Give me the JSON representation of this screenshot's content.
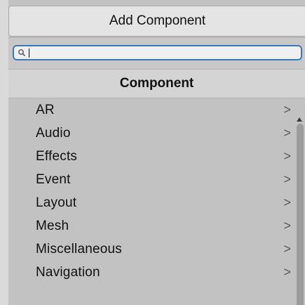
{
  "button": {
    "label": "Add Component"
  },
  "search": {
    "value": "",
    "placeholder": ""
  },
  "section": {
    "title": "Component"
  },
  "items": [
    {
      "label": "AR",
      "chevron": ">"
    },
    {
      "label": "Audio",
      "chevron": ">"
    },
    {
      "label": "Effects",
      "chevron": ">"
    },
    {
      "label": "Event",
      "chevron": ">"
    },
    {
      "label": "Layout",
      "chevron": ">"
    },
    {
      "label": "Mesh",
      "chevron": ">"
    },
    {
      "label": "Miscellaneous",
      "chevron": ">"
    },
    {
      "label": "Navigation",
      "chevron": ">"
    }
  ],
  "colors": {
    "accent": "#3a79bb",
    "background": "#c2c2c2"
  },
  "icons": {
    "search": "search-icon",
    "submenu": "chevron-right-icon",
    "scroll_up": "scroll-up-arrow-icon"
  }
}
